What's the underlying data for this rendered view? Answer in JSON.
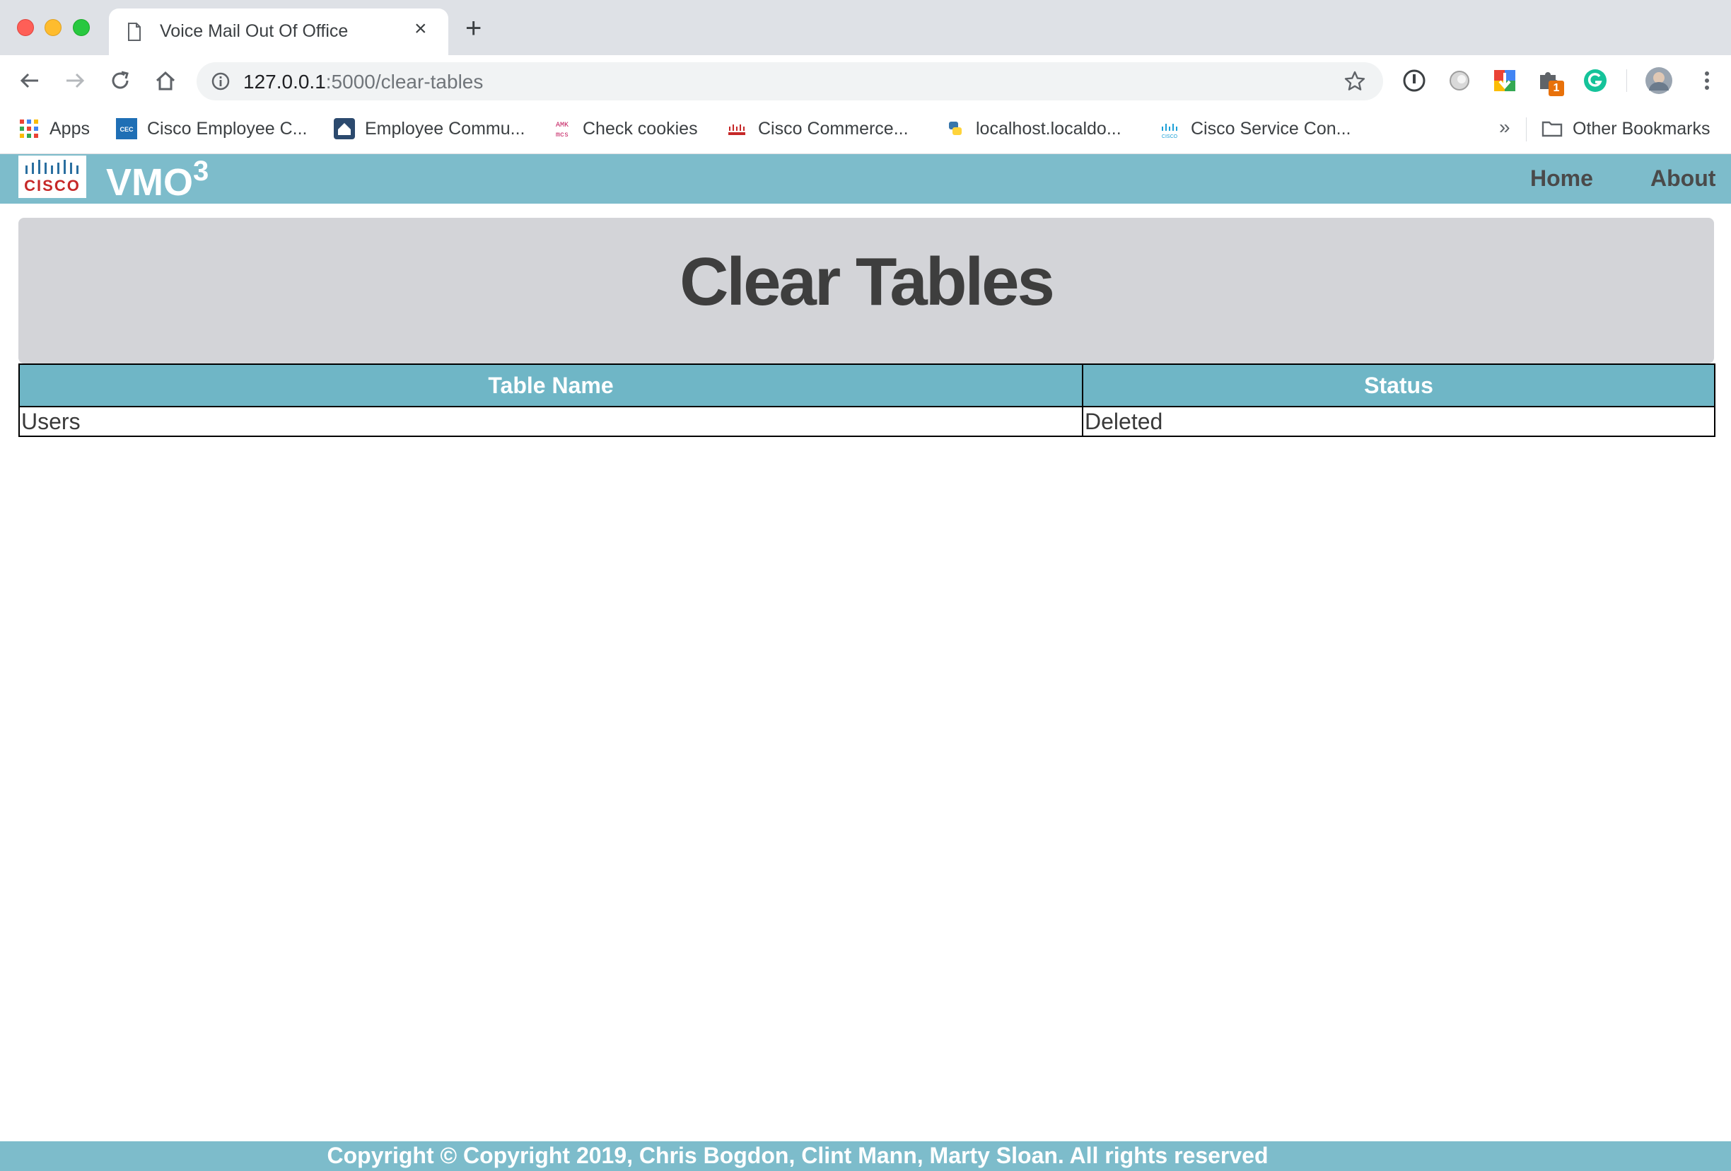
{
  "browser": {
    "tab_title": "Voice Mail Out Of Office",
    "url_host": "127.0.0.1",
    "url_path": ":5000/clear-tables",
    "new_tab": "+",
    "close_tab": "×",
    "ext_badge": "1",
    "overflow": "»"
  },
  "bookmarks": [
    {
      "label": "Apps",
      "icon": "apps-grid-icon"
    },
    {
      "label": "Cisco Employee C...",
      "icon": "cec-icon"
    },
    {
      "label": "Employee Commu...",
      "icon": "home-icon"
    },
    {
      "label": "Check cookies",
      "icon": "amk-mcs-icon"
    },
    {
      "label": "Cisco Commerce...",
      "icon": "cisco-icon"
    },
    {
      "label": "localhost.localdo...",
      "icon": "python-icon"
    },
    {
      "label": "Cisco Service Con...",
      "icon": "cisco-icon"
    },
    {
      "label": "Other Bookmarks",
      "icon": "folder-icon"
    }
  ],
  "app": {
    "logo_text": "CISCO",
    "brand": "VMO",
    "brand_sup": "3",
    "nav": {
      "home": "Home",
      "about": "About"
    }
  },
  "hero": {
    "title": "Clear Tables"
  },
  "table": {
    "headers": [
      "Table Name",
      "Status"
    ],
    "rows": [
      [
        "Users",
        "Deleted"
      ]
    ]
  },
  "footer": {
    "text": "Copyright © Copyright 2019, Chris Bogdon, Clint Mann, Marty Sloan. All rights reserved"
  },
  "colors": {
    "navbar": "#7dbccb",
    "table_header": "#6fb6c6",
    "hero_bg": "#d3d4d8"
  }
}
